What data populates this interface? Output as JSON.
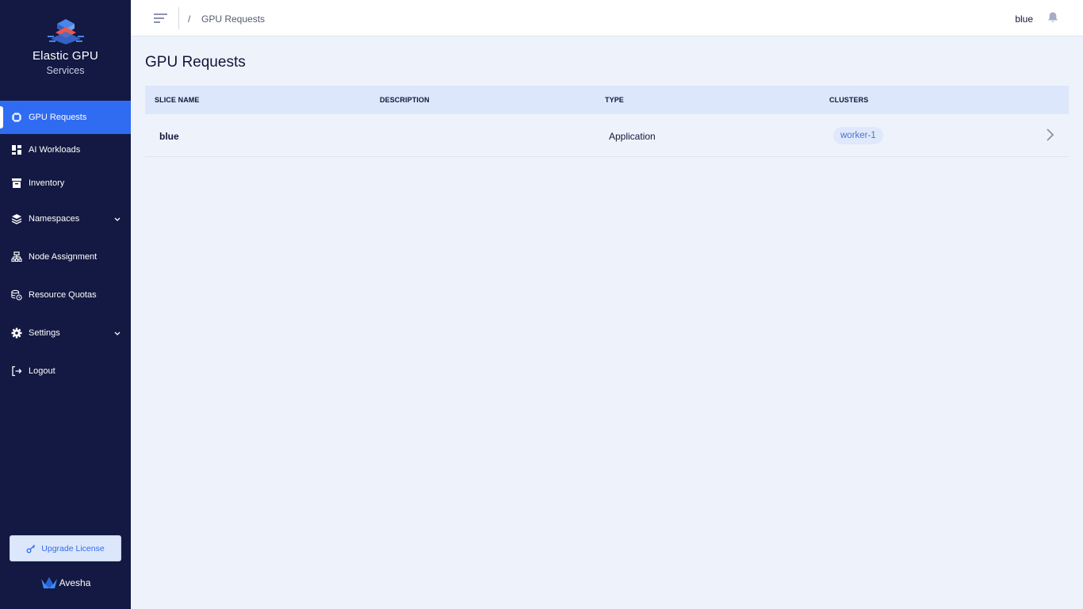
{
  "brand": {
    "title": "Elastic GPU",
    "subtitle": "Services"
  },
  "sidebar": {
    "items": [
      {
        "label": "GPU Requests",
        "icon": "chip-icon",
        "active": true
      },
      {
        "label": "AI Workloads",
        "icon": "dashboard-icon"
      },
      {
        "label": "Inventory",
        "icon": "archive-icon"
      },
      {
        "label": "Namespaces",
        "icon": "layers-icon",
        "expandable": true
      },
      {
        "label": "Node Assignment",
        "icon": "sitemap-icon"
      },
      {
        "label": "Resource Quotas",
        "icon": "database-clock-icon"
      },
      {
        "label": "Settings",
        "icon": "gear-icon",
        "expandable": true
      },
      {
        "label": "Logout",
        "icon": "logout-icon"
      }
    ],
    "upgrade_label": "Upgrade License",
    "footer_brand": "Avesha"
  },
  "header": {
    "breadcrumb_sep": "/",
    "breadcrumb": "GPU Requests",
    "user": "blue"
  },
  "main": {
    "title": "GPU Requests",
    "table": {
      "columns": [
        "SLICE NAME",
        "DESCRIPTION",
        "TYPE",
        "CLUSTERS"
      ],
      "rows": [
        {
          "slice_name": "blue",
          "description": "",
          "type": "Application",
          "clusters": [
            "worker-1"
          ]
        }
      ]
    }
  },
  "colors": {
    "sidebar_bg": "#131942",
    "accent": "#2f6cf2",
    "page_bg": "#eef3fb",
    "table_header_bg": "#dce7fb"
  }
}
